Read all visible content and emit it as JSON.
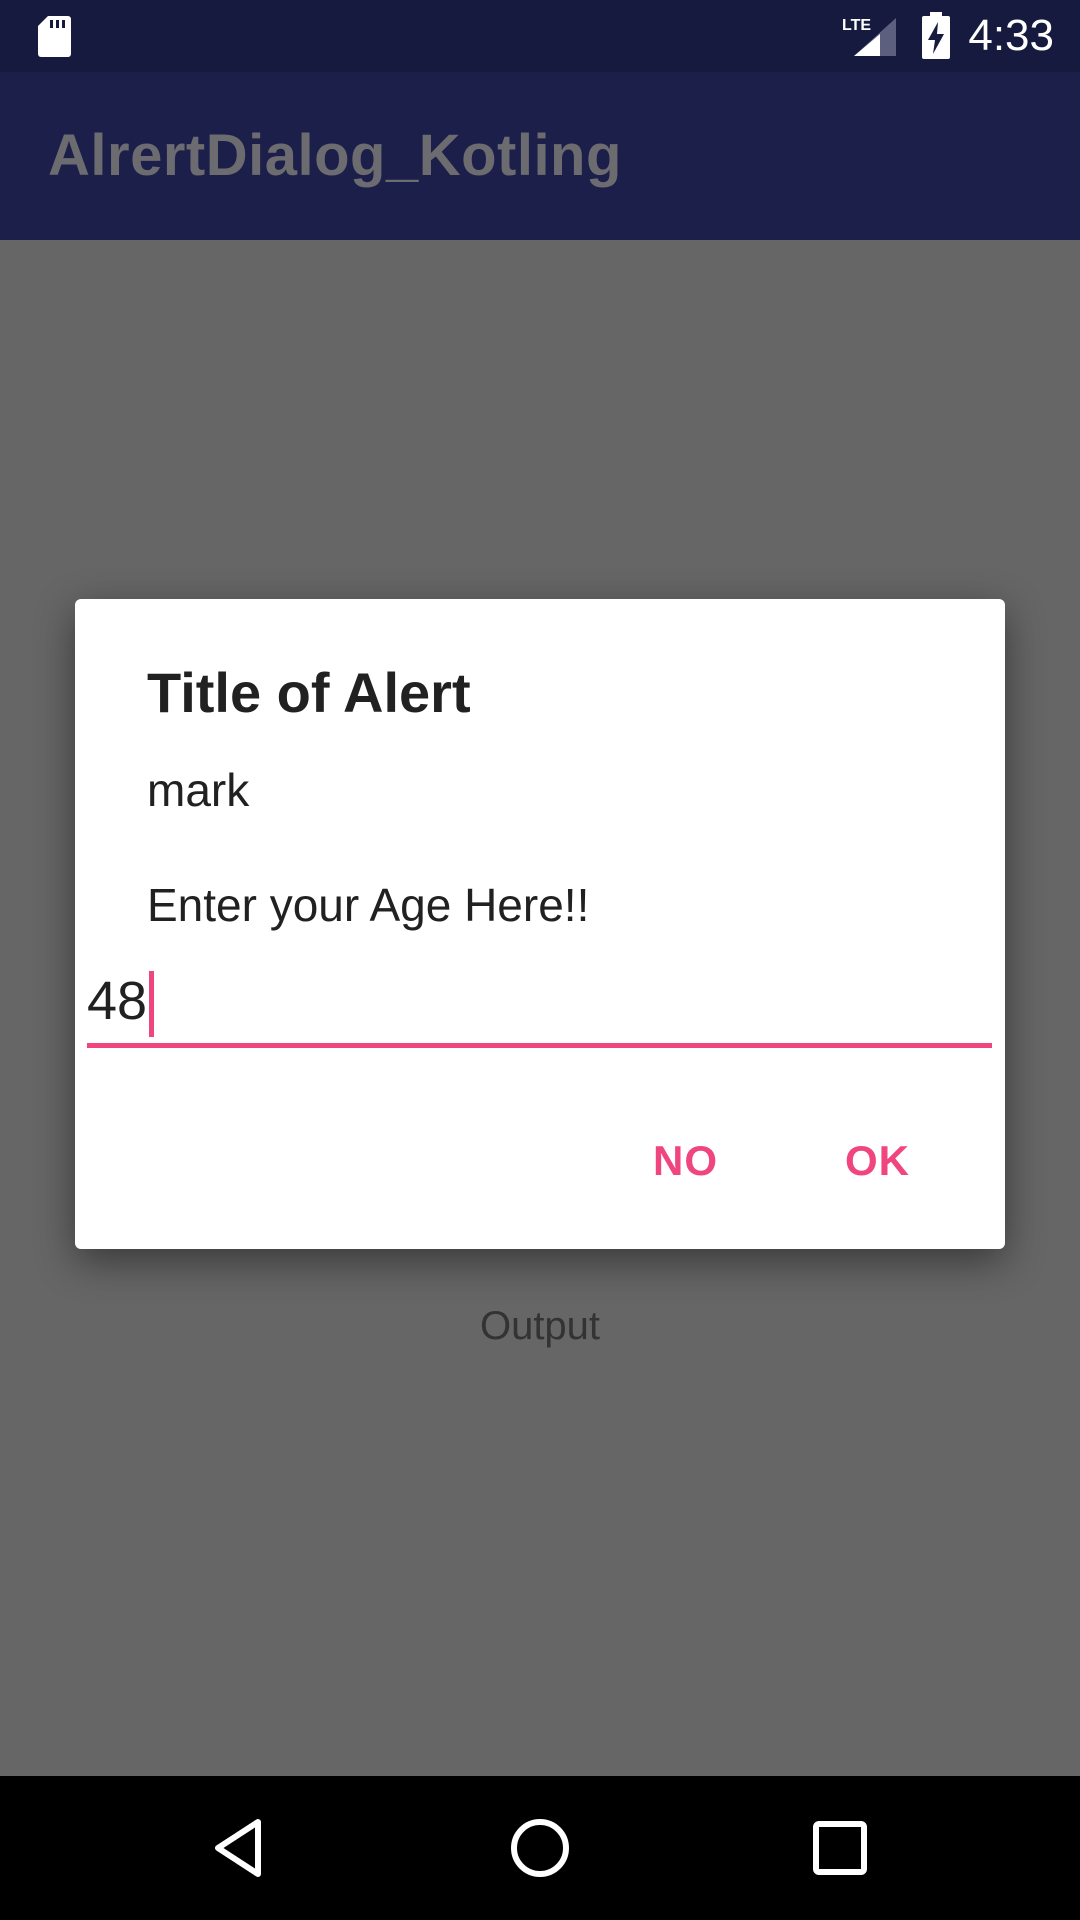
{
  "status_bar": {
    "time": "4:33",
    "network_label": "LTE",
    "icons": [
      "sd-card-icon",
      "lte-signal-icon",
      "battery-charging-icon"
    ]
  },
  "app_bar": {
    "title": "AlrertDialog_Kotling"
  },
  "dialog": {
    "title": "Title of Alert",
    "message": "mark",
    "prompt": "Enter your Age Here!!",
    "input_value": "48",
    "buttons": {
      "negative": "NO",
      "positive": "OK"
    }
  },
  "main": {
    "output_label": "Output"
  },
  "nav_bar": {
    "icons": [
      "back-icon",
      "home-icon",
      "recents-icon"
    ]
  },
  "colors": {
    "status_bar": "#161a3f",
    "app_bar": "#1b1f4a",
    "accent": "#f0467f",
    "scrim": "#666666"
  }
}
